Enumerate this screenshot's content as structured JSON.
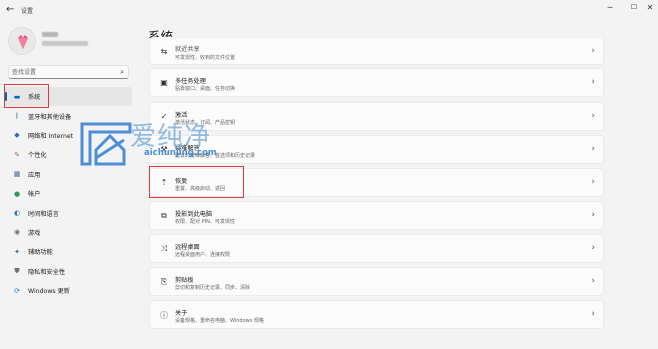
{
  "window": {
    "back_glyph": "←",
    "app_title": "设置",
    "min_glyph": "─",
    "max_glyph": "☐",
    "close_glyph": "✕"
  },
  "search": {
    "placeholder": "查找设置",
    "icon": "search-icon"
  },
  "sidebar": {
    "items": [
      {
        "label": "系统",
        "icon": "monitor-icon",
        "color": "#0067c0",
        "glyph": "▬"
      },
      {
        "label": "蓝牙和其他设备",
        "icon": "bluetooth-icon",
        "color": "#0f6cbd",
        "glyph": "ᛒ"
      },
      {
        "label": "网络和 Internet",
        "icon": "network-icon",
        "color": "#2b6fc4",
        "glyph": "◆"
      },
      {
        "label": "个性化",
        "icon": "brush-icon",
        "color": "#c4633a",
        "glyph": "✎"
      },
      {
        "label": "应用",
        "icon": "apps-icon",
        "color": "#4a6b8f",
        "glyph": "▦"
      },
      {
        "label": "帐户",
        "icon": "account-icon",
        "color": "#2e9b5f",
        "glyph": "●"
      },
      {
        "label": "时间和语言",
        "icon": "clock-globe-icon",
        "color": "#2c7cc7",
        "glyph": "◐"
      },
      {
        "label": "游戏",
        "icon": "game-icon",
        "color": "#6d7480",
        "glyph": "◉"
      },
      {
        "label": "辅助功能",
        "icon": "accessibility-icon",
        "color": "#1f6fc0",
        "glyph": "✦"
      },
      {
        "label": "隐私和安全性",
        "icon": "shield-icon",
        "color": "#69727d",
        "glyph": "⛊"
      },
      {
        "label": "Windows 更新",
        "icon": "update-icon",
        "color": "#0d79d1",
        "glyph": "⟳"
      }
    ]
  },
  "main": {
    "title": "系统",
    "cards": [
      {
        "title": "就近共享",
        "subtitle": "可发现性、收到的文件位置",
        "icon": "share-icon",
        "glyph": "⇆"
      },
      {
        "title": "多任务处理",
        "subtitle": "贴靠窗口、桌面、任务切换",
        "icon": "multitask-icon",
        "glyph": "▣"
      },
      {
        "title": "激活",
        "subtitle": "激活状态、订阅、产品密钥",
        "icon": "activation-icon",
        "glyph": "✓"
      },
      {
        "title": "疑难解答",
        "subtitle": "建议的疑难解答、首选项和历史记录",
        "icon": "wrench-icon",
        "glyph": "⚒"
      },
      {
        "title": "恢复",
        "subtitle": "重置、高级启动、返回",
        "icon": "recovery-icon",
        "glyph": "⇡"
      },
      {
        "title": "投影到此电脑",
        "subtitle": "权限、配对 PIN、可发现性",
        "icon": "projection-icon",
        "glyph": "⧉"
      },
      {
        "title": "远程桌面",
        "subtitle": "远程桌面用户、连接权限",
        "icon": "remote-desktop-icon",
        "glyph": "⤨"
      },
      {
        "title": "剪贴板",
        "subtitle": "剪切和复制历史记录、同步、清除",
        "icon": "clipboard-icon",
        "glyph": "⎘"
      },
      {
        "title": "关于",
        "subtitle": "设备规格、重命名电脑、Windows 规格",
        "icon": "info-icon",
        "glyph": "ⓘ"
      }
    ]
  },
  "watermark": {
    "text": "爱纯净",
    "url": "aichunjing.com"
  }
}
